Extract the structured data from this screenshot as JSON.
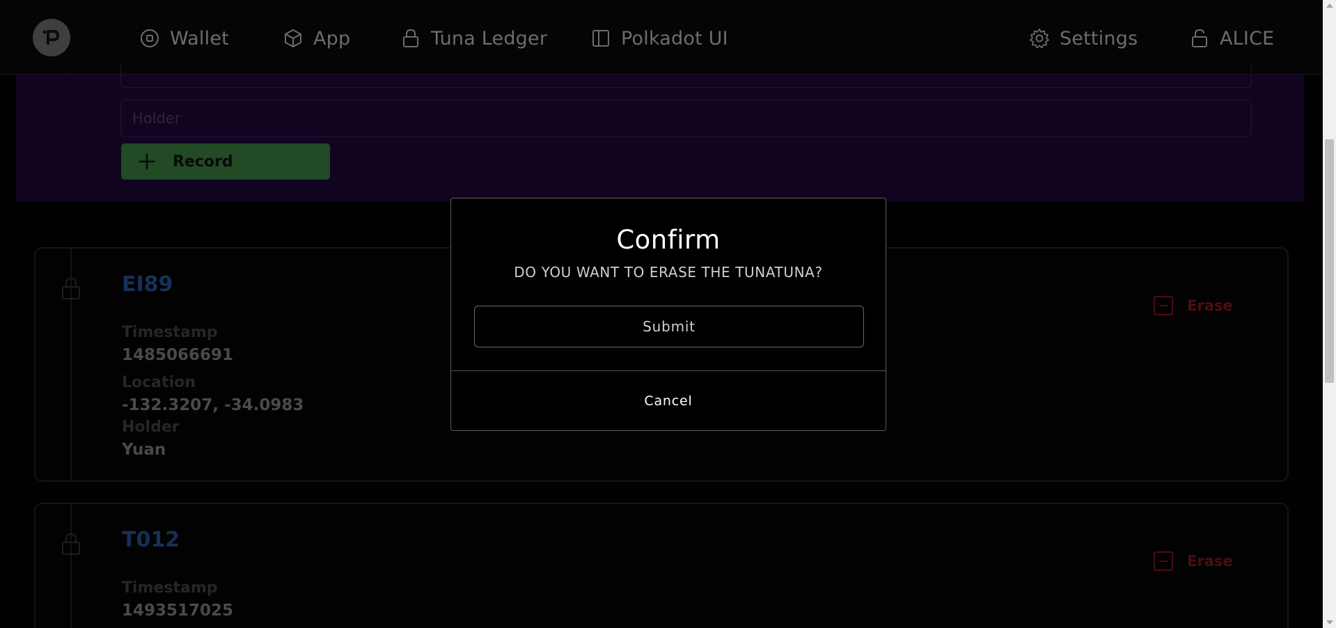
{
  "nav": {
    "items": [
      {
        "label": "Wallet",
        "icon": "wallet-icon"
      },
      {
        "label": "App",
        "icon": "cube-icon"
      },
      {
        "label": "Tuna Ledger",
        "icon": "lock-icon"
      },
      {
        "label": "Polkadot UI",
        "icon": "sidebar-layout-icon"
      }
    ],
    "settings_label": "Settings",
    "account_label": "ALICE"
  },
  "form": {
    "holder_placeholder": "Holder",
    "record_label": "Record"
  },
  "records": [
    {
      "id": "EI89",
      "timestamp_label": "Timestamp",
      "timestamp": "1485066691",
      "location_label": "Location",
      "location": "-132.3207, -34.0983",
      "holder_label": "Holder",
      "holder": "Yuan",
      "erase_label": "Erase"
    },
    {
      "id": "T012",
      "timestamp_label": "Timestamp",
      "timestamp": "1493517025",
      "erase_label": "Erase"
    }
  ],
  "modal": {
    "title": "Confirm",
    "message": "DO YOU WANT TO ERASE THE TUNATUNA?",
    "submit_label": "Submit",
    "cancel_label": "Cancel"
  },
  "colors": {
    "background": "#010101",
    "form_panel": "#110420",
    "record_button": "#214a25",
    "erase": "#4b0d15",
    "record_id": "#173059"
  }
}
